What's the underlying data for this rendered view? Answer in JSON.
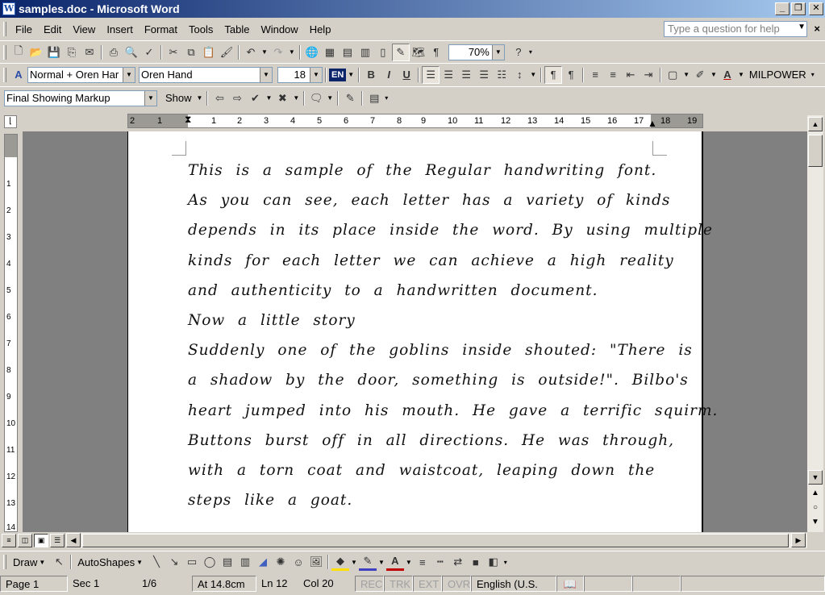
{
  "window": {
    "title": "samples.doc - Microsoft Word",
    "app_icon": "W",
    "buttons": {
      "minimize": "_",
      "maximize": "❐",
      "close": "✕"
    }
  },
  "menu": {
    "items": [
      "File",
      "Edit",
      "View",
      "Insert",
      "Format",
      "Tools",
      "Table",
      "Window",
      "Help"
    ],
    "help_placeholder": "Type a question for help",
    "doc_close": "×"
  },
  "standard_toolbar": {
    "zoom": "70%"
  },
  "formatting_toolbar": {
    "style": "Normal + Oren Har",
    "font": "Oren Hand",
    "font_size": "18",
    "language": "EN",
    "bold": "B",
    "italic": "I",
    "underline": "U",
    "font_color_label": "A",
    "extra_label": "MILPOWER"
  },
  "reviewing_toolbar": {
    "markup_mode": "Final Showing Markup",
    "show_label": "Show"
  },
  "ruler": {
    "h_ticks": [
      "2",
      "1",
      "1",
      "2",
      "3",
      "4",
      "5",
      "6",
      "7",
      "8",
      "9",
      "10",
      "11",
      "12",
      "13",
      "14",
      "15",
      "16",
      "17",
      "18",
      "19"
    ],
    "v_ticks": [
      "1",
      "2",
      "3",
      "4",
      "5",
      "6",
      "7",
      "8",
      "9",
      "10",
      "11",
      "12",
      "13",
      "14"
    ]
  },
  "document": {
    "lines": [
      "This is a sample of the Regular handwriting font.",
      "As you can see, each letter has a variety of kinds",
      "depends in its place inside the word. By using multiple",
      "kinds for each letter we can achieve a high reality",
      "and authenticity to a handwritten document.",
      "Now a little story",
      "Suddenly one of the goblins inside shouted: \"There is",
      "a shadow by the door, something is outside!\". Bilbo's",
      "heart jumped into his mouth. He gave a terrific squirm.",
      "Buttons burst off in all directions. He was through,",
      "with a torn coat and waistcoat, leaping down the",
      "steps like a goat."
    ]
  },
  "drawing_toolbar": {
    "draw_label": "Draw",
    "autoshapes_label": "AutoShapes"
  },
  "status": {
    "page": "Page 1",
    "section": "Sec 1",
    "page_of": "1/6",
    "at": "At 14.8cm",
    "line": "Ln 12",
    "col": "Col 20",
    "rec": "REC",
    "trk": "TRK",
    "ext": "EXT",
    "ovr": "OVR",
    "language": "English (U.S."
  }
}
